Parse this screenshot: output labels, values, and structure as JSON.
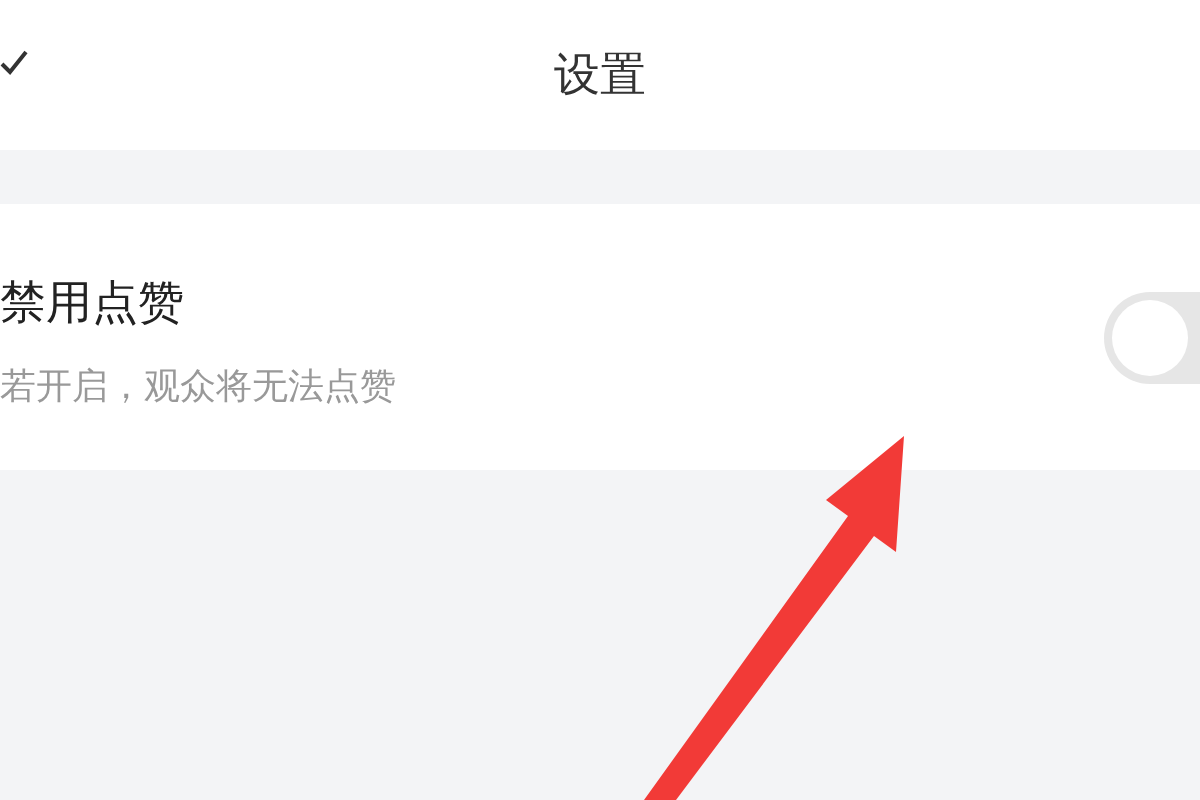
{
  "header": {
    "title": "设置"
  },
  "setting": {
    "title": "禁用点赞",
    "description": "若开启，观众将无法点赞",
    "on": false
  }
}
